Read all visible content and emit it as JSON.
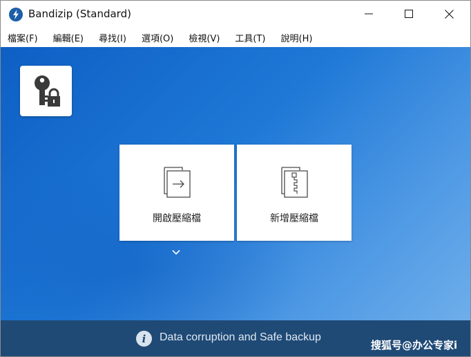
{
  "window": {
    "title": "Bandizip (Standard)"
  },
  "menu": {
    "items": [
      {
        "label": "檔案(F)"
      },
      {
        "label": "編輯(E)"
      },
      {
        "label": "尋找(I)"
      },
      {
        "label": "選項(O)"
      },
      {
        "label": "檢視(V)"
      },
      {
        "label": "工具(T)"
      },
      {
        "label": "說明(H)"
      }
    ]
  },
  "main": {
    "key_tile_icon": "key-lock-icon",
    "open_archive_label": "開啟壓縮檔",
    "new_archive_label": "新增壓縮檔"
  },
  "footer": {
    "info_text": "Data corruption and Safe backup",
    "watermark": "搜狐号@办公专家i"
  },
  "colors": {
    "main_blue": "#1e78d6",
    "footer_bg": "#1f4a76"
  }
}
